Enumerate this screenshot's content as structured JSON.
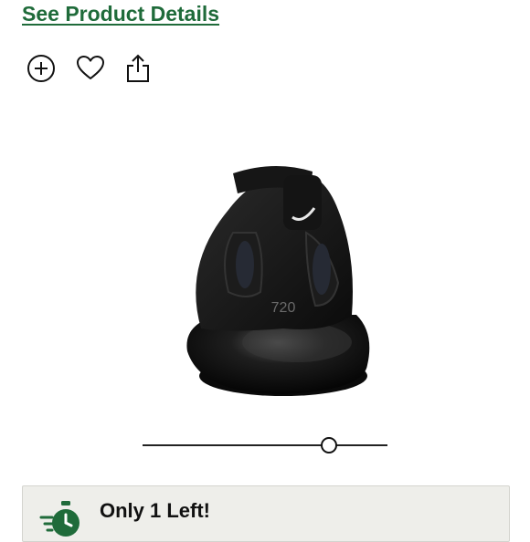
{
  "header": {
    "details_link": "See Product Details"
  },
  "actions": [
    {
      "name": "add-icon",
      "label": "Add"
    },
    {
      "name": "heart-icon",
      "label": "Favorite"
    },
    {
      "name": "share-icon",
      "label": "Share"
    }
  ],
  "product_image": {
    "description_icon": "shoe-image",
    "logo_text": "720"
  },
  "slider": {
    "value_fraction": 0.76
  },
  "stock": {
    "message": "Only 1 Left!",
    "icon": "stopwatch-icon"
  },
  "colors": {
    "link": "#1f6b3a",
    "banner_bg": "#eeeeea",
    "icon_green": "#1f6b3a"
  }
}
